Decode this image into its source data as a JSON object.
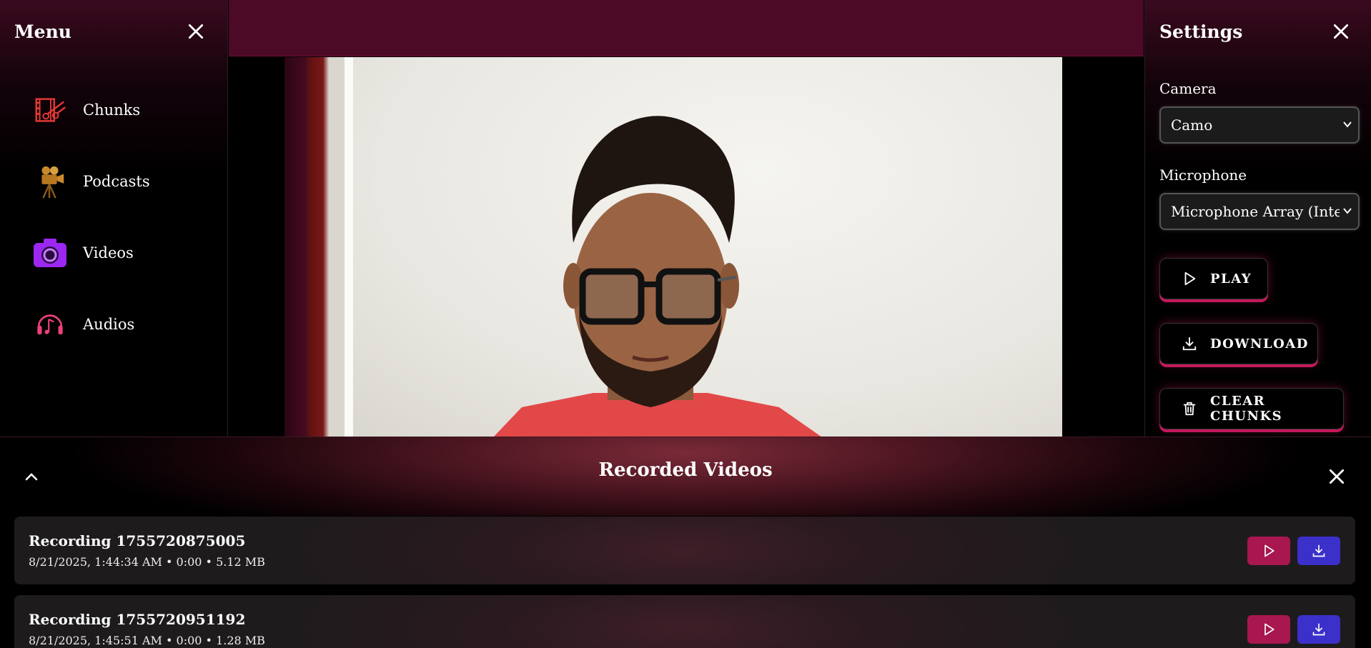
{
  "menu": {
    "title": "Menu",
    "items": [
      {
        "label": "Chunks",
        "icon": "film-scissors-icon",
        "color": "#e53935"
      },
      {
        "label": "Podcasts",
        "icon": "movie-camera-icon",
        "color": "#c98a2a"
      },
      {
        "label": "Videos",
        "icon": "camera-icon",
        "color": "#9c27f0"
      },
      {
        "label": "Audios",
        "icon": "headphones-music-icon",
        "color": "#ec407a"
      }
    ]
  },
  "settings": {
    "title": "Settings",
    "camera_label": "Camera",
    "camera_value": "Camo",
    "microphone_label": "Microphone",
    "microphone_value": "Microphone Array (Intel®",
    "play_label": "PLAY",
    "download_label": "DOWNLOAD",
    "clear_label": "CLEAR CHUNKS"
  },
  "recorded": {
    "title": "Recorded Videos",
    "items": [
      {
        "name": "Recording 1755720875005",
        "meta": "8/21/2025, 1:44:34 AM • 0:00 • 5.12 MB"
      },
      {
        "name": "Recording 1755720951192",
        "meta": "8/21/2025, 1:45:51 AM • 0:00 • 1.28 MB"
      }
    ]
  },
  "colors": {
    "accent": "#c2185b",
    "topbar": "#4d0a26",
    "play_button": "#a8174f",
    "download_button": "#3b30c9"
  }
}
